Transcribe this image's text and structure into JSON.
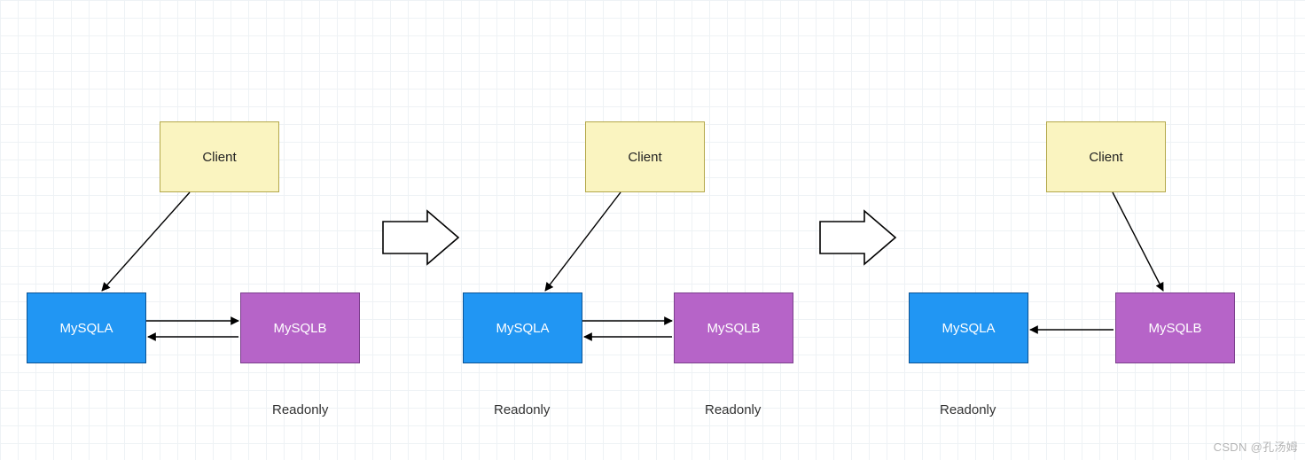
{
  "nodes": {
    "client": "Client",
    "mysqla": "MySQLA",
    "mysqlb": "MySQLB"
  },
  "labels": {
    "readonly": "Readonly"
  },
  "watermark": "CSDN @孔汤姆",
  "colors": {
    "client_bg": "#faf4c0",
    "client_border": "#b3a84a",
    "mysqla_bg": "#2196f3",
    "mysqla_border": "#0b5394",
    "mysqlb_bg": "#b664c8",
    "mysqlb_border": "#7b3f8c",
    "grid": "#eef2f5"
  },
  "diagram": {
    "description": "Three stages of MySQL dual-master failover with a Client. In each stage Client points to one MySQL node; MySQLA and MySQLB replicate bidirectionally. Large block arrows indicate progression between stages. Readonly labels appear under nodes.",
    "stages": [
      {
        "client_target": "MySQLA",
        "readonly_under": [
          "MySQLB"
        ],
        "bidirectional": true
      },
      {
        "client_target": "MySQLA",
        "readonly_under": [
          "MySQLA",
          "MySQLB"
        ],
        "bidirectional": true
      },
      {
        "client_target": "MySQLB",
        "readonly_under": [
          "MySQLA"
        ],
        "bidirectional": false,
        "arrow": "MySQLB_to_MySQLA"
      }
    ]
  }
}
